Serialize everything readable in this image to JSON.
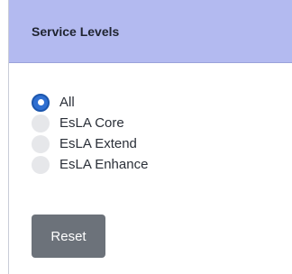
{
  "panel": {
    "title": "Service Levels"
  },
  "service_levels": {
    "selected": "All",
    "options": [
      {
        "label": "All",
        "checked": true
      },
      {
        "label": "EsLA Core",
        "checked": false
      },
      {
        "label": "EsLA Extend",
        "checked": false
      },
      {
        "label": "EsLA Enhance",
        "checked": false
      }
    ]
  },
  "actions": {
    "reset_label": "Reset"
  },
  "colors": {
    "header_background": "#b3baf0",
    "radio_selected": "#2f6fd1",
    "radio_unselected": "#e6e7ea",
    "reset_button": "#6c727a"
  }
}
